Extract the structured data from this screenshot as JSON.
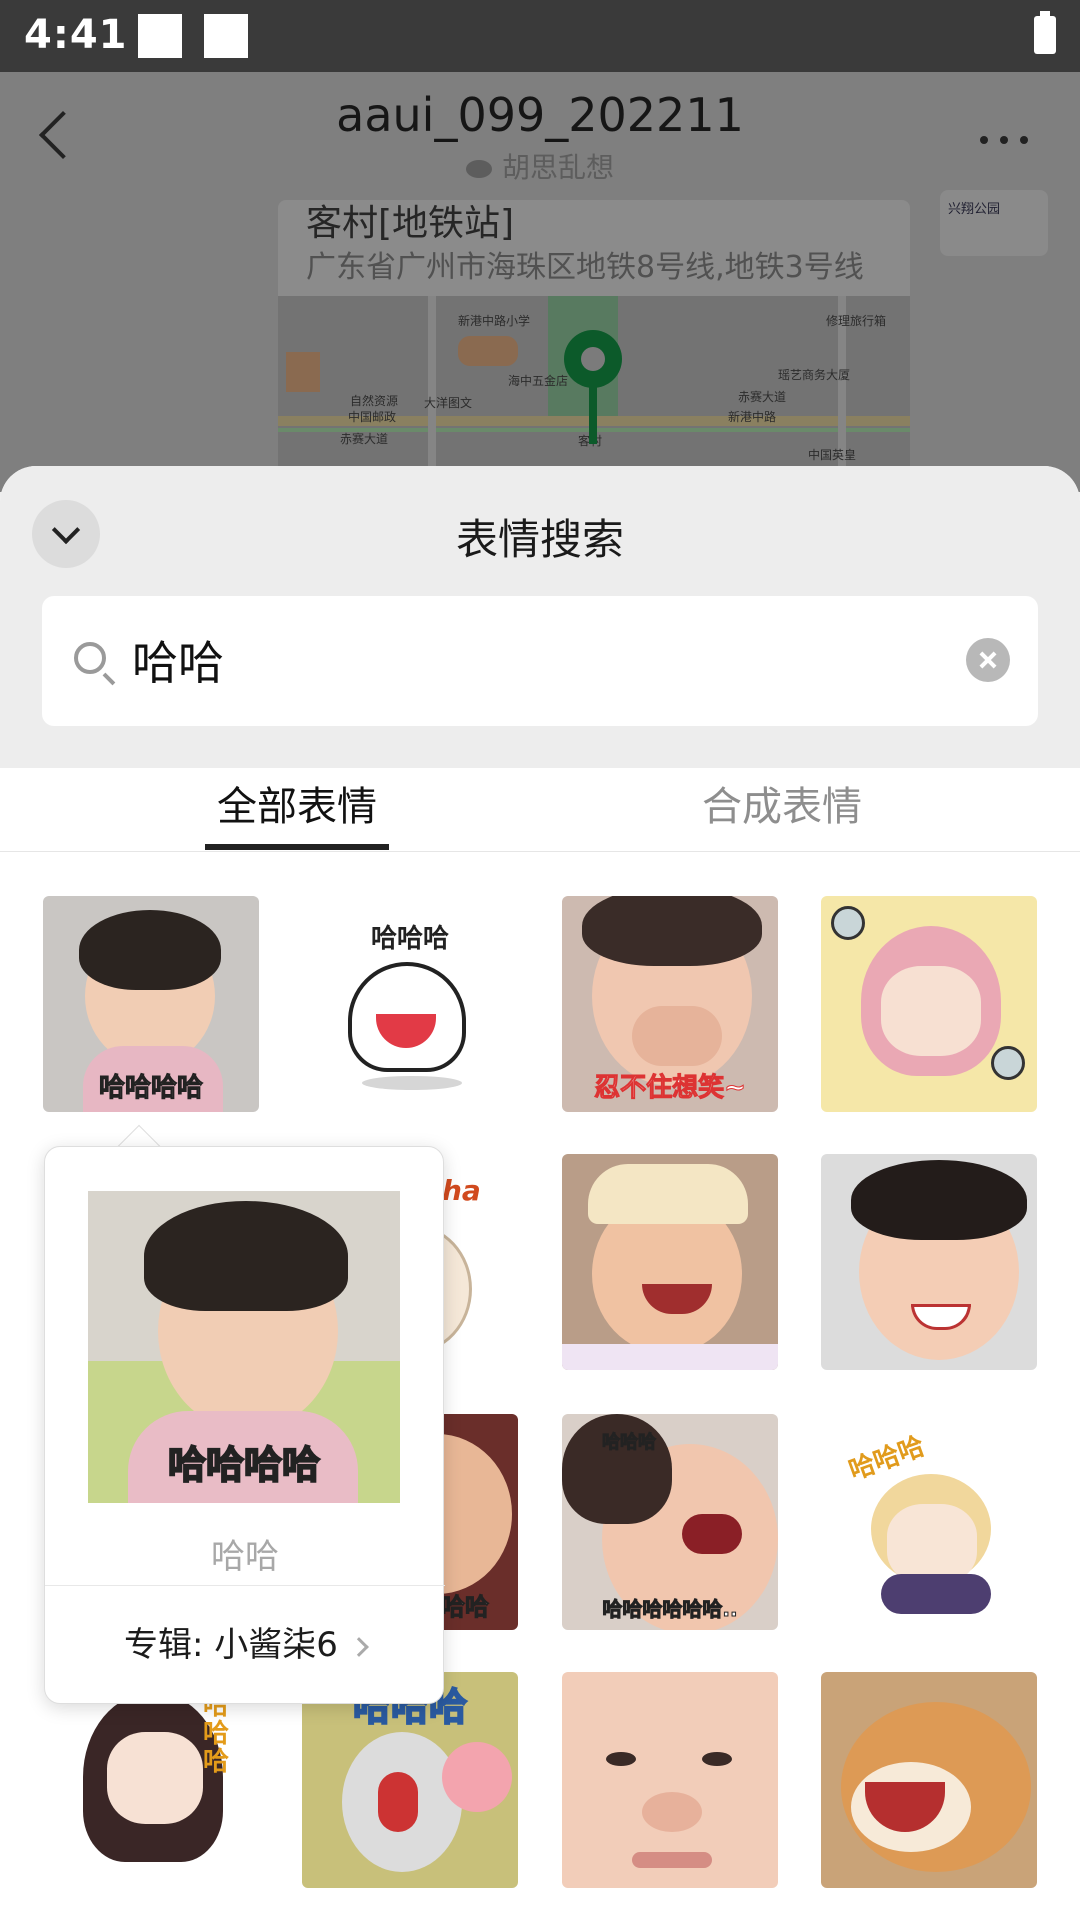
{
  "status": {
    "time": "4:41"
  },
  "chat": {
    "title": "aaui_099_202211",
    "subtitle": "胡思乱想",
    "location": {
      "name": "客村[地铁站]",
      "address": "广东省广州市海珠区地铁8号线,地铁3号线",
      "map_labels": [
        "新港中路小学",
        "修理旅行箱",
        "海中五金店",
        "瑶艺商务大厦",
        "赤赛大道",
        "新港中路",
        "中国邮政",
        "大洋图文",
        "自然资源",
        "客村",
        "赤赛大道",
        "中国英皇"
      ]
    },
    "side_logo_text": "兴翔公园"
  },
  "sheet": {
    "title": "表情搜索",
    "search": {
      "value": "哈哈",
      "placeholder": ""
    },
    "tabs": [
      {
        "label": "全部表情",
        "selected": true
      },
      {
        "label": "合成表情",
        "selected": false
      }
    ],
    "stickers": [
      {
        "caption": "哈哈哈哈"
      },
      {
        "caption": "哈哈哈"
      },
      {
        "caption": "忍不住想笑~"
      },
      {
        "caption": ""
      },
      {
        "caption": "ha"
      },
      {
        "caption": ""
      },
      {
        "caption": ""
      },
      {
        "caption": "哈哈"
      },
      {
        "caption": "哈哈哈"
      },
      {
        "caption": "哈哈哈哈哈哈.."
      },
      {
        "caption": "哈哈哈"
      },
      {
        "caption": "哈哈哈"
      },
      {
        "caption": "哈哈哈"
      },
      {
        "caption": ""
      },
      {
        "caption": ""
      }
    ]
  },
  "popup": {
    "image_caption": "哈哈哈哈",
    "caption": "哈哈",
    "album": "专辑: 小酱柒6"
  }
}
